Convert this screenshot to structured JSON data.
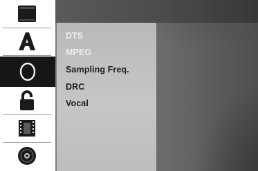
{
  "sidebar": {
    "items": [
      {
        "icon": "disc-tray-icon",
        "active": false
      },
      {
        "icon": "language-letter-a-icon",
        "active": false
      },
      {
        "icon": "audio-circle-icon",
        "active": true
      },
      {
        "icon": "padlock-icon",
        "active": false
      },
      {
        "icon": "film-strip-icon",
        "active": false
      },
      {
        "icon": "disc-icon",
        "active": false
      }
    ],
    "active_bg": "#161616",
    "icon_color": "#1a1a1a"
  },
  "panel": {
    "header_title": ""
  },
  "menu": {
    "items": [
      {
        "label": "DTS",
        "enabled": false
      },
      {
        "label": "MPEG",
        "enabled": false
      },
      {
        "label": "Sampling Freq.",
        "enabled": true
      },
      {
        "label": "DRC",
        "enabled": true
      },
      {
        "label": "Vocal",
        "enabled": true
      }
    ],
    "disabled_color": "#eeeeee",
    "enabled_color": "#1f1f1f"
  }
}
